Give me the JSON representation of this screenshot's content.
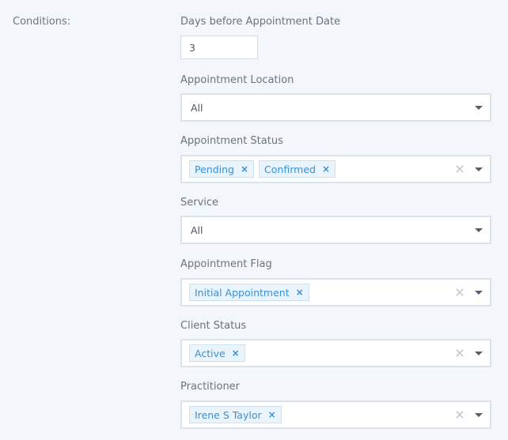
{
  "section_label": "Conditions:",
  "days_before": {
    "label": "Days before Appointment Date",
    "value": "3"
  },
  "appointment_location": {
    "label": "Appointment Location",
    "value": "All"
  },
  "appointment_status": {
    "label": "Appointment Status",
    "tags": [
      "Pending",
      "Confirmed"
    ]
  },
  "service": {
    "label": "Service",
    "value": "All"
  },
  "appointment_flag": {
    "label": "Appointment Flag",
    "tags": [
      "Initial Appointment"
    ]
  },
  "client_status": {
    "label": "Client Status",
    "tags": [
      "Active"
    ]
  },
  "practitioner": {
    "label": "Practitioner",
    "tags": [
      "Irene S Taylor"
    ]
  },
  "icons": {
    "tag_remove": "×",
    "clear": "×"
  }
}
